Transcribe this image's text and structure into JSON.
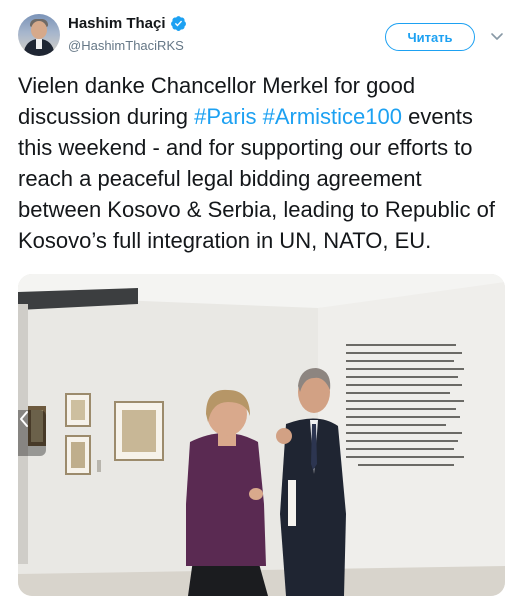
{
  "author": {
    "display_name": "Hashim Thaçi",
    "handle": "@HashimThaciRKS",
    "verified": true,
    "avatar_icon": "user-avatar"
  },
  "actions": {
    "follow_label": "Читать",
    "menu_icon": "chevron-down-icon"
  },
  "tweet": {
    "text_before": "Vielen danke Chancellor Merkel for good discussion during ",
    "hashtag_1": "#Paris",
    "hashtag_2": "#Armistice100",
    "text_after": " events this weekend - and for supporting our efforts to reach a peaceful legal bidding agreement between Kosovo & Serbia, leading to Republic of Kosovo’s full integration in UN, NATO, EU."
  },
  "media": {
    "wall_title_line1": "L’exposition",
    "wall_title_line2": "à la galerie Vollard",
    "nav_icon": "chevron-left-icon"
  },
  "colors": {
    "accent": "#1da1f2",
    "text": "#14171a",
    "secondary": "#657786"
  }
}
